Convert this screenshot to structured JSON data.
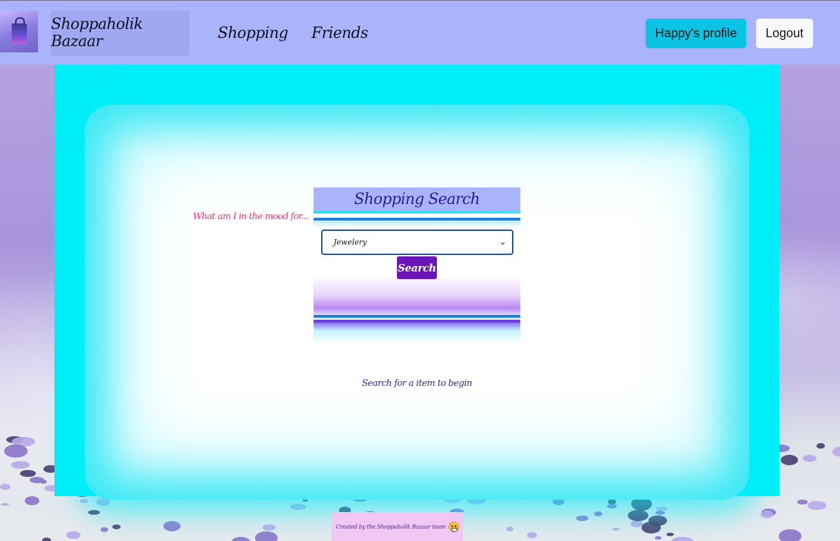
{
  "navbar": {
    "brand": "Shoppaholik Bazaar",
    "links": [
      "Shopping",
      "Friends"
    ],
    "profile_button": "Happy's profile",
    "logout_button": "Logout",
    "logo_icon": "shopping-bag-logo"
  },
  "main": {
    "mood_label": "What am I in the mood for...",
    "search": {
      "title": "Shopping Search",
      "selected_category": "Jewelery",
      "button_label": "Search"
    },
    "hint": "Search for a item to begin"
  },
  "footer": {
    "text": "Created by the Shoppaholik Bazaar team",
    "emoji_icon": "grinning-face"
  },
  "colors": {
    "navbar": "#aab4fb",
    "profile_button": "#0bc3e3",
    "search_button": "#6a15b8",
    "frame": "#00eef8",
    "mood_label": "#ff2d7a",
    "hint": "#3a1aa8",
    "footer": "#f3c7f3"
  }
}
